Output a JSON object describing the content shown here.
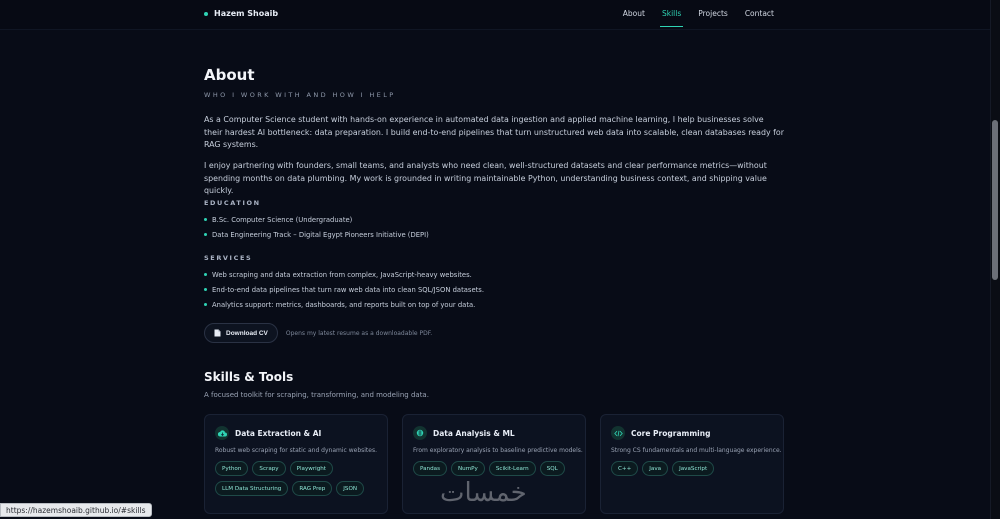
{
  "header": {
    "brand": "Hazem Shoaib",
    "nav": [
      {
        "label": "About",
        "active": false
      },
      {
        "label": "Skills",
        "active": true
      },
      {
        "label": "Projects",
        "active": false
      },
      {
        "label": "Contact",
        "active": false
      }
    ]
  },
  "about": {
    "title": "About",
    "kicker": "WHO I WORK WITH AND HOW I HELP",
    "paragraphs": [
      "As a Computer Science student with hands-on experience in automated data ingestion and applied machine learning, I help businesses solve their hardest AI bottleneck: data preparation. I build end-to-end pipelines that turn unstructured web data into scalable, clean databases ready for RAG systems.",
      "I enjoy partnering with founders, small teams, and analysts who need clean, well-structured datasets and clear performance metrics—without spending months on data plumbing. My work is grounded in writing maintainable Python, understanding business context, and shipping value quickly."
    ],
    "education_label": "EDUCATION",
    "education": [
      "B.Sc. Computer Science (Undergraduate)",
      "Data Engineering Track – Digital Egypt Pioneers Initiative (DEPI)"
    ],
    "services_label": "SERVICES",
    "services": [
      "Web scraping and data extraction from complex, JavaScript-heavy websites.",
      "End-to-end data pipelines that turn raw web data into clean SQL/JSON datasets.",
      "Analytics support: metrics, dashboards, and reports built on top of your data."
    ],
    "cv_button": "Download CV",
    "cv_note": "Opens my latest resume as a downloadable PDF."
  },
  "skills": {
    "title": "Skills & Tools",
    "subtitle": "A focused toolkit for scraping, transforming, and modeling data.",
    "cards": [
      {
        "icon": "cloud-download-icon",
        "title": "Data Extraction & AI",
        "desc": "Robust web scraping for static and dynamic websites.",
        "chips": [
          "Python",
          "Scrapy",
          "Playwright",
          "LLM Data Structuring",
          "RAG Prep",
          "JSON"
        ]
      },
      {
        "icon": "brain-icon",
        "title": "Data Analysis & ML",
        "desc": "From exploratory analysis to baseline predictive models.",
        "chips": [
          "Pandas",
          "NumPy",
          "Scikit-Learn",
          "SQL"
        ]
      },
      {
        "icon": "code-icon",
        "title": "Core Programming",
        "desc": "Strong CS fundamentals and multi-language experience.",
        "chips": [
          "C++",
          "Java",
          "JavaScript"
        ]
      }
    ]
  },
  "statusbar": {
    "url": "https://hazemshoaib.github.io/#skills"
  },
  "watermark": {
    "text": "خمسات"
  },
  "colors": {
    "accent": "#2fd3b4",
    "background": "#080c17"
  }
}
